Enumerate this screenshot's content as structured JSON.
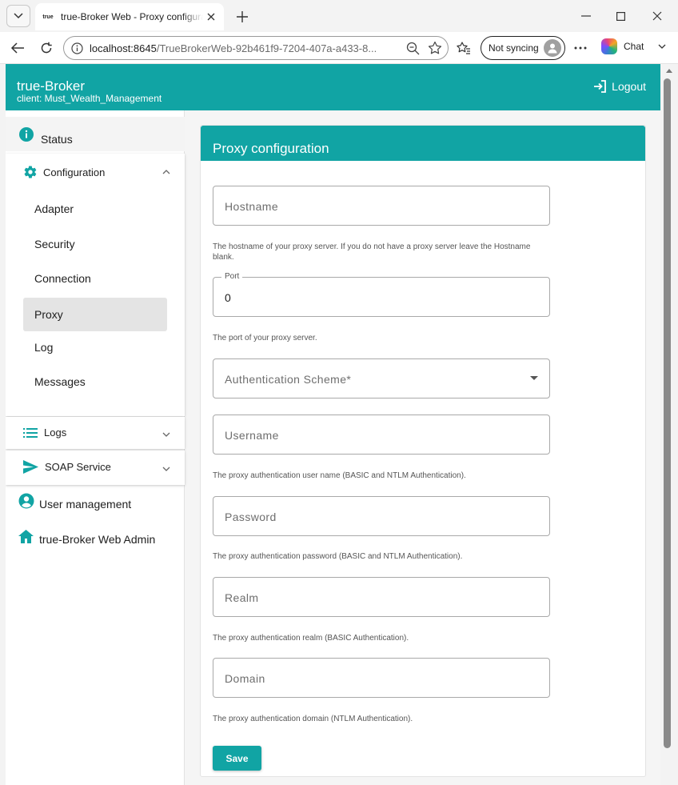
{
  "browser": {
    "tab_title": "true-Broker Web - Proxy configuration",
    "tab_favicon_text": "true",
    "address_host": "localhost:8645",
    "address_path": "/TrueBrokerWeb-92b461f9-7204-407a-a433-8...",
    "profile_label": "Not syncing",
    "chat_label": "Chat"
  },
  "header": {
    "app_name": "true-Broker",
    "client": "client: Must_Wealth_Management",
    "logout": "Logout"
  },
  "sidebar": {
    "status": "Status",
    "configuration": "Configuration",
    "config_items": [
      "Adapter",
      "Security",
      "Connection",
      "Proxy",
      "Log",
      "Messages"
    ],
    "active_item": "Proxy",
    "logs": "Logs",
    "soap": "SOAP Service",
    "user_management": "User management",
    "admin": "true-Broker Web Admin"
  },
  "form": {
    "title": "Proxy configuration",
    "hostname": {
      "placeholder": "Hostname",
      "hint": "The hostname of your proxy server. If you do not have a proxy server leave the Hostname blank."
    },
    "port": {
      "label": "Port",
      "value": "0",
      "hint": "The port of your proxy server."
    },
    "auth_scheme": {
      "placeholder": "Authentication Scheme*"
    },
    "username": {
      "placeholder": "Username",
      "hint": "The proxy authentication user name (BASIC and NTLM Authentication)."
    },
    "password": {
      "placeholder": "Password",
      "hint": "The proxy authentication password (BASIC and NTLM Authentication)."
    },
    "realm": {
      "placeholder": "Realm",
      "hint": "The proxy authentication realm (BASIC Authentication)."
    },
    "domain": {
      "placeholder": "Domain",
      "hint": "The proxy authentication domain (NTLM Authentication)."
    },
    "save": "Save"
  },
  "colors": {
    "accent": "#11a4a4",
    "sidebar_active": "#e4e4e4"
  },
  "icons": {
    "info": "info-icon",
    "config": "gear-icon",
    "logs": "list-icon",
    "soap": "send-icon",
    "user": "account-icon",
    "admin": "home-icon",
    "logout": "logout-icon"
  }
}
